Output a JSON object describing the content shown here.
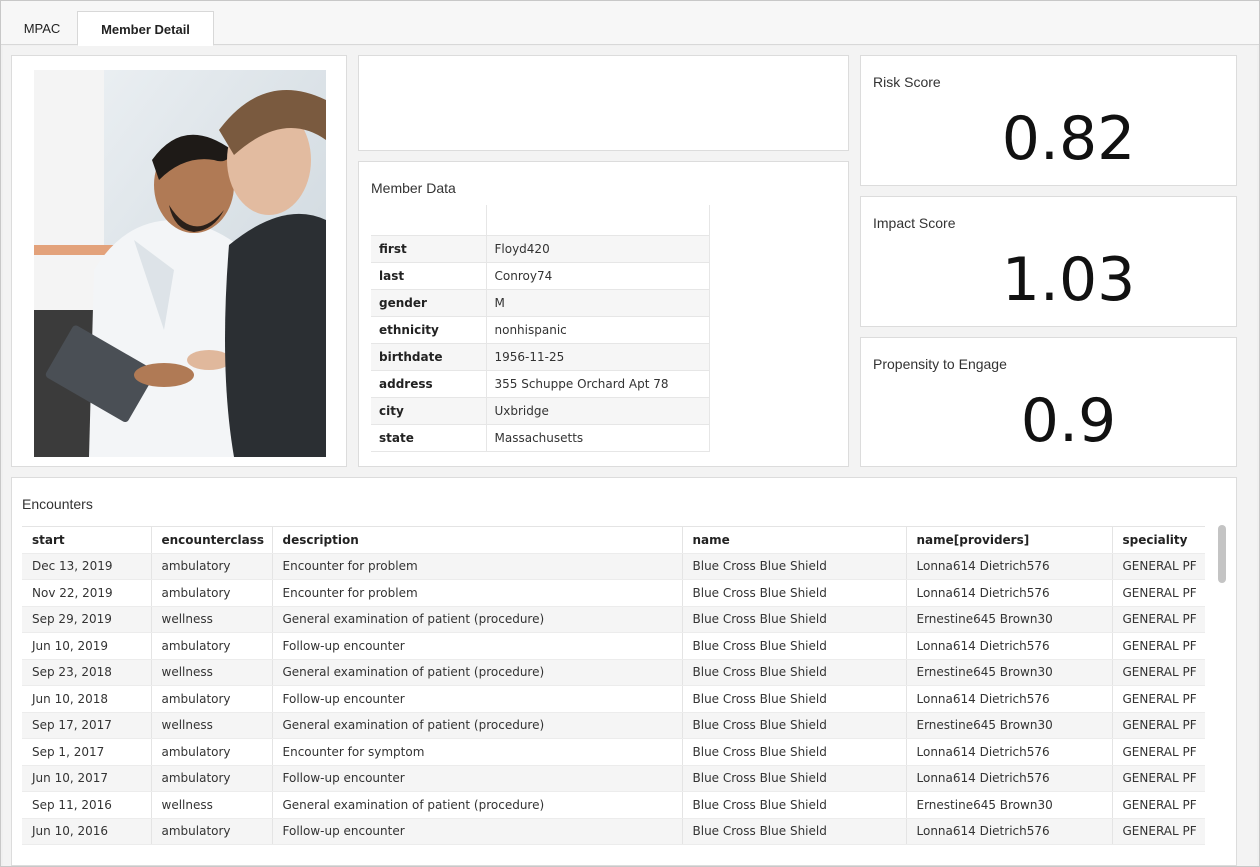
{
  "tabs": [
    {
      "label": "MPAC"
    },
    {
      "label": "Member Detail"
    }
  ],
  "member_data": {
    "title": "Member Data",
    "rows": [
      {
        "key": "first",
        "value": "Floyd420"
      },
      {
        "key": "last",
        "value": "Conroy74"
      },
      {
        "key": "gender",
        "value": "M"
      },
      {
        "key": "ethnicity",
        "value": "nonhispanic"
      },
      {
        "key": "birthdate",
        "value": "1956-11-25"
      },
      {
        "key": "address",
        "value": "355 Schuppe Orchard Apt 78"
      },
      {
        "key": "city",
        "value": "Uxbridge"
      },
      {
        "key": "state",
        "value": "Massachusetts"
      }
    ]
  },
  "kpis": {
    "risk": {
      "label": "Risk Score",
      "value": "0.82"
    },
    "impact": {
      "label": "Impact Score",
      "value": "1.03"
    },
    "propensity": {
      "label": "Propensity to Engage",
      "value": "0.9"
    }
  },
  "encounters": {
    "title": "Encounters",
    "columns": [
      "start",
      "encounterclass",
      "description",
      "name",
      "name[providers]",
      "speciality"
    ],
    "rows": [
      [
        "Dec 13, 2019",
        "ambulatory",
        "Encounter for problem",
        "Blue Cross Blue Shield",
        "Lonna614 Dietrich576",
        "GENERAL PF"
      ],
      [
        "Nov 22, 2019",
        "ambulatory",
        "Encounter for problem",
        "Blue Cross Blue Shield",
        "Lonna614 Dietrich576",
        "GENERAL PF"
      ],
      [
        "Sep 29, 2019",
        "wellness",
        "General examination of patient (procedure)",
        "Blue Cross Blue Shield",
        "Ernestine645 Brown30",
        "GENERAL PF"
      ],
      [
        "Jun 10, 2019",
        "ambulatory",
        "Follow-up encounter",
        "Blue Cross Blue Shield",
        "Lonna614 Dietrich576",
        "GENERAL PF"
      ],
      [
        "Sep 23, 2018",
        "wellness",
        "General examination of patient (procedure)",
        "Blue Cross Blue Shield",
        "Ernestine645 Brown30",
        "GENERAL PF"
      ],
      [
        "Jun 10, 2018",
        "ambulatory",
        "Follow-up encounter",
        "Blue Cross Blue Shield",
        "Lonna614 Dietrich576",
        "GENERAL PF"
      ],
      [
        "Sep 17, 2017",
        "wellness",
        "General examination of patient (procedure)",
        "Blue Cross Blue Shield",
        "Ernestine645 Brown30",
        "GENERAL PF"
      ],
      [
        "Sep 1, 2017",
        "ambulatory",
        "Encounter for symptom",
        "Blue Cross Blue Shield",
        "Lonna614 Dietrich576",
        "GENERAL PF"
      ],
      [
        "Jun 10, 2017",
        "ambulatory",
        "Follow-up encounter",
        "Blue Cross Blue Shield",
        "Lonna614 Dietrich576",
        "GENERAL PF"
      ],
      [
        "Sep 11, 2016",
        "wellness",
        "General examination of patient (procedure)",
        "Blue Cross Blue Shield",
        "Ernestine645 Brown30",
        "GENERAL PF"
      ],
      [
        "Jun 10, 2016",
        "ambulatory",
        "Follow-up encounter",
        "Blue Cross Blue Shield",
        "Lonna614 Dietrich576",
        "GENERAL PF"
      ]
    ]
  }
}
